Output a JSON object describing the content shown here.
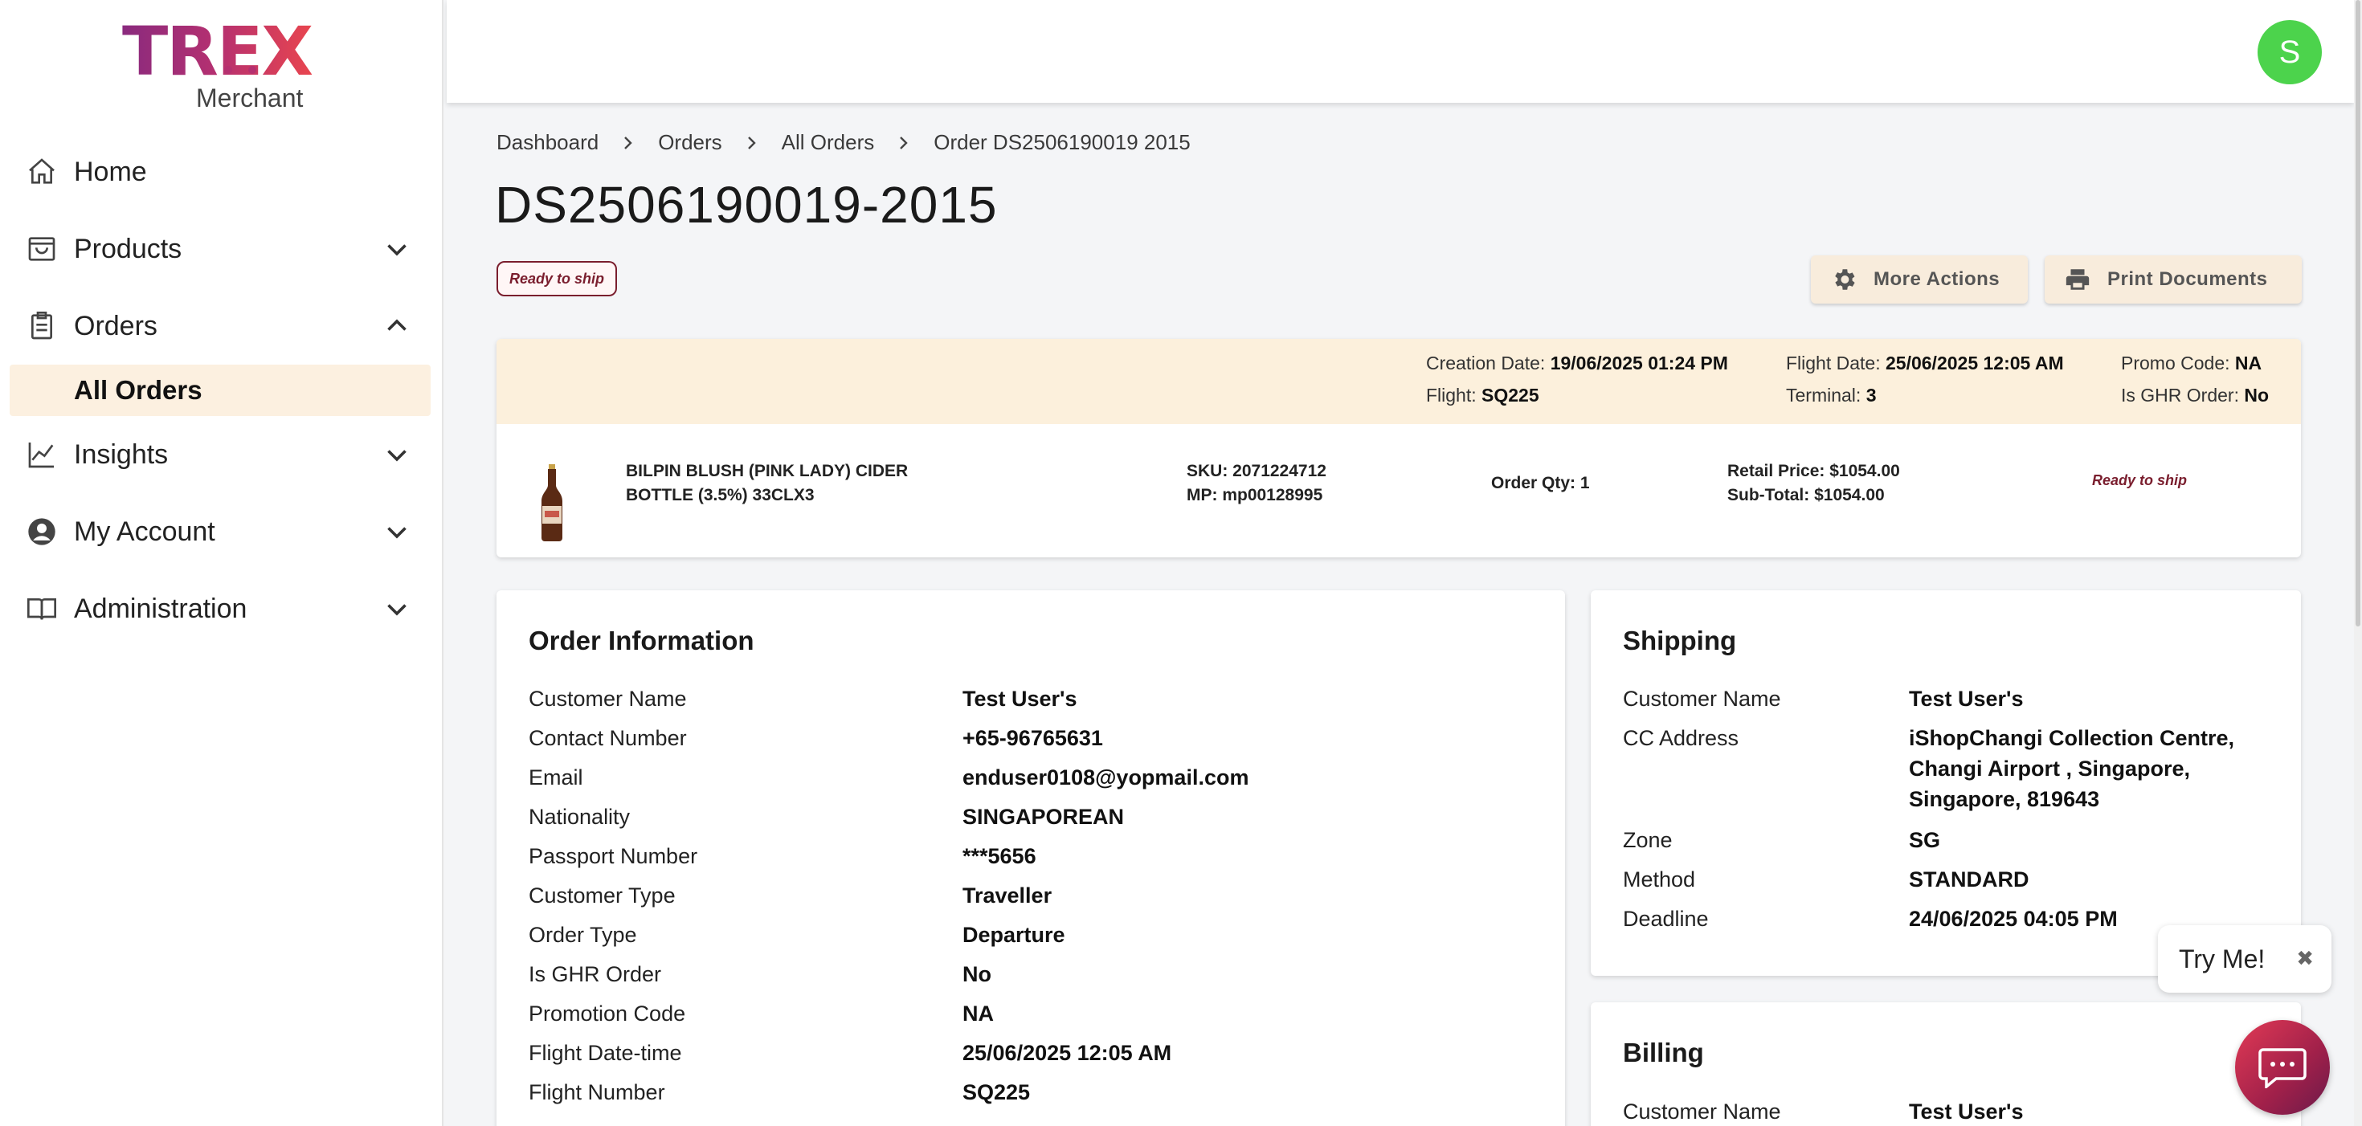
{
  "brand": {
    "logo_text": "TREX",
    "sub_text": "Merchant"
  },
  "sidebar": {
    "items": [
      {
        "label": "Home",
        "icon": "home-icon"
      },
      {
        "label": "Products",
        "icon": "shopping-bag-icon"
      },
      {
        "label": "Orders",
        "icon": "clipboard-icon"
      },
      {
        "label": "All Orders"
      },
      {
        "label": "Insights",
        "icon": "chart-line-icon"
      },
      {
        "label": "My Account",
        "icon": "user-circle-icon"
      },
      {
        "label": "Administration",
        "icon": "book-icon"
      }
    ]
  },
  "topbar": {
    "avatar_initial": "S"
  },
  "breadcrumb": [
    "Dashboard",
    "Orders",
    "All Orders",
    "Order DS2506190019 2015"
  ],
  "page": {
    "title": "DS2506190019-2015",
    "status": "Ready to ship",
    "more_actions": "More Actions",
    "print_documents": "Print Documents"
  },
  "order_header": {
    "creation_date_label": "Creation Date:",
    "creation_date": "19/06/2025 01:24 PM",
    "flight_label": "Flight:",
    "flight": "SQ225",
    "flight_date_label": "Flight Date:",
    "flight_date": "25/06/2025 12:05 AM",
    "terminal_label": "Terminal:",
    "terminal": "3",
    "promo_label": "Promo Code:",
    "promo": "NA",
    "ghr_label": "Is GHR Order:",
    "ghr": "No"
  },
  "order_line": {
    "name_line1": "BILPIN BLUSH (PINK LADY) CIDER",
    "name_line2": "BOTTLE (3.5%) 33CLX3",
    "sku": "SKU: 2071224712",
    "mp": "MP: mp00128995",
    "qty": "Order Qty: 1",
    "retail": "Retail Price: $1054.00",
    "subtotal": "Sub-Total: $1054.00",
    "status": "Ready to ship"
  },
  "order_info": {
    "title": "Order Information",
    "rows": [
      {
        "k": "Customer Name",
        "v": "Test User's"
      },
      {
        "k": "Contact Number",
        "v": "+65-96765631"
      },
      {
        "k": "Email",
        "v": "enduser0108@yopmail.com"
      },
      {
        "k": "Nationality",
        "v": "SINGAPOREAN"
      },
      {
        "k": "Passport Number",
        "v": "***5656"
      },
      {
        "k": "Customer Type",
        "v": "Traveller"
      },
      {
        "k": "Order Type",
        "v": "Departure"
      },
      {
        "k": "Is GHR Order",
        "v": "No"
      },
      {
        "k": "Promotion Code",
        "v": "NA"
      },
      {
        "k": "Flight Date-time",
        "v": "25/06/2025 12:05 AM"
      },
      {
        "k": "Flight Number",
        "v": "SQ225"
      }
    ]
  },
  "shipping": {
    "title": "Shipping",
    "rows": [
      {
        "k": "Customer Name",
        "v": "Test User's"
      },
      {
        "k": "CC Address",
        "v": "iShopChangi Collection Centre, Changi Airport , Singapore, Singapore, 819643"
      },
      {
        "k": "Zone",
        "v": "SG"
      },
      {
        "k": "Method",
        "v": "STANDARD"
      },
      {
        "k": "Deadline",
        "v": "24/06/2025 04:05 PM"
      }
    ]
  },
  "billing": {
    "title": "Billing",
    "rows": [
      {
        "k": "Customer Name",
        "v": "Test User's"
      }
    ]
  },
  "widgets": {
    "try_me": "Try Me!",
    "close_glyph": "✖"
  },
  "colors": {
    "accent_bg": "#fcf0dc",
    "status": "#7a1e2e",
    "avatar": "#4cd34c",
    "chat": "#c8284a"
  }
}
